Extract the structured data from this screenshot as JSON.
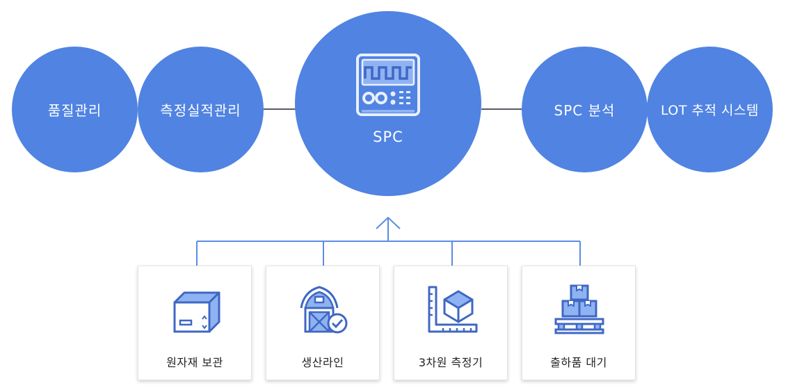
{
  "top_nodes": {
    "quality": "품질관리",
    "measurement": "측정실적관리",
    "center": "SPC",
    "analysis": "SPC 분석",
    "lot": "LOT 추적 시스템"
  },
  "sources": [
    {
      "label": "원자재 보관",
      "icon": "box-icon"
    },
    {
      "label": "생산라인",
      "icon": "barn-check-icon"
    },
    {
      "label": "3차원 측정기",
      "icon": "ruler-cube-icon"
    },
    {
      "label": "출하품 대기",
      "icon": "pallet-boxes-icon"
    }
  ],
  "colors": {
    "node": "#5083e2",
    "line": "#5a8ce6",
    "icon_dark": "#3f67c4",
    "icon_light": "#8fb3f2"
  }
}
